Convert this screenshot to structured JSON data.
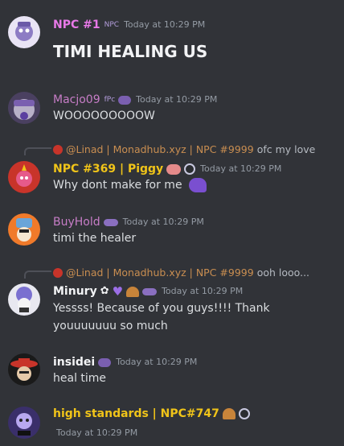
{
  "messages": [
    {
      "author": "NPC #1",
      "author_color": "#e879e8",
      "badge": "NPC",
      "timestamp": "Today at 10:29 PM",
      "text": "TIMI HEALING US"
    },
    {
      "author": "Macjo09",
      "author_color": "#c77dc7",
      "badge": "fPc",
      "timestamp": "Today at 10:29 PM",
      "text": "WOOOOOOOOOW"
    },
    {
      "reply_to": "@Linad | Monadhub.xyz | NPC #9999",
      "reply_text": "ofc my love",
      "author": "NPC #369 | Piggy",
      "author_color": "#f0c419",
      "timestamp": "Today at 10:29 PM",
      "text": "Why dont make for me"
    },
    {
      "author": "BuyHold",
      "author_color": "#c77dc7",
      "timestamp": "Today at 10:29 PM",
      "text": "timi the healer"
    },
    {
      "reply_to": "@Linad | Monadhub.xyz | NPC #9999",
      "reply_text": "ooh looo...",
      "author": "Minury",
      "author_color": "#f2f3f5",
      "timestamp": "Today at 10:29 PM",
      "text_line1": "Yessss! Because of you guys!!!! Thank",
      "text_line2": "youuuuuuu so much"
    },
    {
      "author": "insidei",
      "author_color": "#f2f3f5",
      "timestamp": "Today at 10:29 PM",
      "text": "heal time"
    },
    {
      "author": "high standards | NPC#747",
      "author_color": "#f0c419",
      "timestamp": "Today at 10:29 PM"
    }
  ]
}
